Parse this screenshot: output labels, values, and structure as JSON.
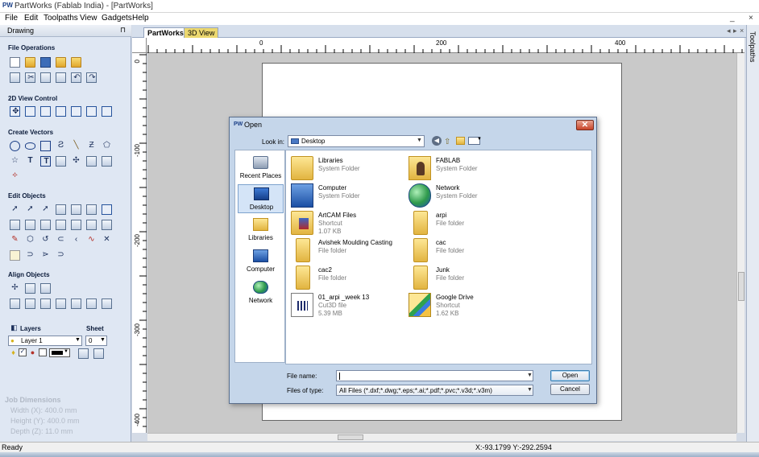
{
  "app": {
    "logo": "PW",
    "title": "PartWorks (Fablab India) - [PartWorks]",
    "window_controls": [
      "_",
      "×"
    ]
  },
  "menu": [
    "File",
    "Edit",
    "Toolpaths",
    "View",
    "Gadgets",
    "Help"
  ],
  "drawing_panel": {
    "header": "Drawing",
    "sections": {
      "file_operations": "File Operations",
      "view_control": "2D View Control",
      "create_vectors": "Create Vectors",
      "edit_objects": "Edit Objects",
      "align_objects": "Align Objects"
    },
    "layers": {
      "label": "Layers",
      "sheet_label": "Sheet",
      "layer_value": "Layer 1",
      "sheet_value": "0"
    },
    "job_dimensions": {
      "title": "Job Dimensions",
      "width": "Width  (X): 400.0 mm",
      "height": "Height (Y): 400.0 mm",
      "depth": "Depth  (Z): 11.0 mm"
    }
  },
  "tabs": [
    {
      "label": "PartWorks",
      "active": true
    },
    {
      "label": "3D View",
      "active": false
    }
  ],
  "tab_nav": {
    "left": "◂",
    "right": "▸",
    "close": "×"
  },
  "right_dock": {
    "label": "Toolpaths"
  },
  "rulers": {
    "h_labels": [
      "0",
      "200",
      "400"
    ],
    "v_labels": [
      "0",
      "-100",
      "-200",
      "-300",
      "-400"
    ]
  },
  "status": {
    "left": "Ready",
    "coords": "X:-93.1799 Y:-292.2594"
  },
  "open_dialog": {
    "logo": "PW",
    "title": "Open",
    "close": "✕",
    "look_in_label": "Look in:",
    "look_in_value": "Desktop",
    "places": [
      {
        "label": "Recent Places",
        "icon": "recent-places-icon",
        "selected": false
      },
      {
        "label": "Desktop",
        "icon": "desktop-icon",
        "selected": true
      },
      {
        "label": "Libraries",
        "icon": "libraries-icon",
        "selected": false
      },
      {
        "label": "Computer",
        "icon": "computer-icon",
        "selected": false
      },
      {
        "label": "Network",
        "icon": "network-icon",
        "selected": false
      }
    ],
    "items": [
      {
        "name": "Libraries",
        "type": "System Folder",
        "size": "",
        "icon": "libraries-icon"
      },
      {
        "name": "FABLAB",
        "type": "System Folder",
        "size": "",
        "icon": "user-folder-icon"
      },
      {
        "name": "Computer",
        "type": "System Folder",
        "size": "",
        "icon": "computer-icon"
      },
      {
        "name": "Network",
        "type": "System Folder",
        "size": "",
        "icon": "network-icon"
      },
      {
        "name": "ArtCAM Files",
        "type": "Shortcut",
        "size": "1.07 KB",
        "icon": "artcam-shortcut-icon"
      },
      {
        "name": "arpi",
        "type": "File folder",
        "size": "",
        "icon": "folder-icon"
      },
      {
        "name": "Avishek Moulding Casting",
        "type": "File folder",
        "size": "",
        "icon": "folder-icon"
      },
      {
        "name": "cac",
        "type": "File folder",
        "size": "",
        "icon": "folder-icon"
      },
      {
        "name": "cac2",
        "type": "File folder",
        "size": "",
        "icon": "folder-icon"
      },
      {
        "name": "Junk",
        "type": "File folder",
        "size": "",
        "icon": "folder-icon"
      },
      {
        "name": "01_arpi _week 13",
        "type": "Cut3D file",
        "size": "5.39 MB",
        "icon": "cut3d-file-icon"
      },
      {
        "name": "Google Drive",
        "type": "Shortcut",
        "size": "1.62 KB",
        "icon": "google-drive-icon"
      }
    ],
    "file_name_label": "File name:",
    "file_name_value": "",
    "file_type_label": "Files of type:",
    "file_type_value": "All Files (*.dxf;*.dwg;*.eps;*.ai;*.pdf;*.pvc;*.v3d;*.v3m)",
    "open_button": "Open",
    "cancel_button": "Cancel"
  }
}
